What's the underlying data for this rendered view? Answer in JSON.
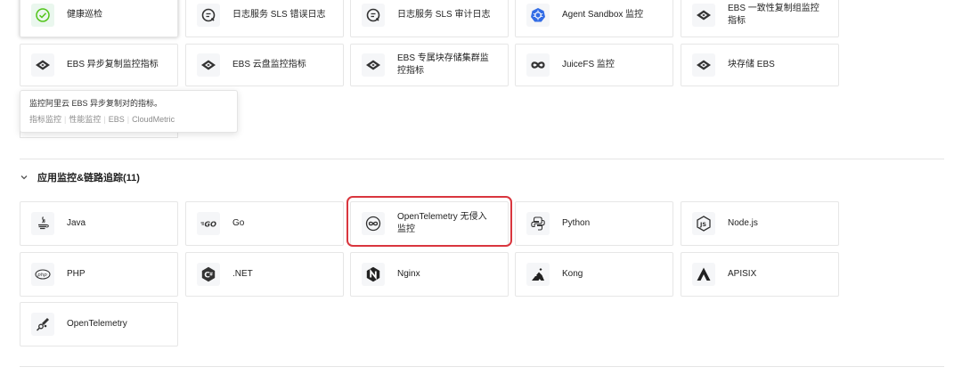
{
  "top_section": {
    "cards": [
      {
        "label": "健康巡检",
        "icon": "check-circle-icon"
      },
      {
        "label": "日志服务 SLS 错误日志",
        "icon": "sls-log-icon"
      },
      {
        "label": "日志服务 SLS 审计日志",
        "icon": "sls-log-icon"
      },
      {
        "label": "Agent Sandbox 监控",
        "icon": "kubernetes-icon"
      },
      {
        "label": "EBS 一致性复制组监控指标",
        "icon": "ebs-icon"
      },
      {
        "label": "EBS 异步复制监控指标",
        "icon": "ebs-icon"
      },
      {
        "label": "EBS 云盘监控指标",
        "icon": "ebs-icon"
      },
      {
        "label": "EBS 专属块存储集群监控指标",
        "icon": "ebs-icon"
      },
      {
        "label": "JuiceFS 监控",
        "icon": "juicefs-icon"
      },
      {
        "label": "块存储 EBS",
        "icon": "ebs-icon"
      }
    ]
  },
  "tooltip": {
    "description": "监控阿里云 EBS 异步复制对的指标。",
    "tags": [
      "指标监控",
      "性能监控",
      "EBS",
      "CloudMetric"
    ]
  },
  "app_section": {
    "title": "应用监控&链路追踪(11)",
    "cards": [
      {
        "label": "Java",
        "icon": "java-icon"
      },
      {
        "label": "Go",
        "icon": "go-icon"
      },
      {
        "label": "OpenTelemetry 无侵入监控",
        "icon": "opentelemetry-infinity-icon"
      },
      {
        "label": "Python",
        "icon": "python-icon"
      },
      {
        "label": "Node.js",
        "icon": "nodejs-icon"
      },
      {
        "label": "PHP",
        "icon": "php-icon"
      },
      {
        "label": ".NET",
        "icon": "dotnet-icon"
      },
      {
        "label": "Nginx",
        "icon": "nginx-icon"
      },
      {
        "label": "Kong",
        "icon": "kong-icon"
      },
      {
        "label": "APISIX",
        "icon": "apisix-icon"
      },
      {
        "label": "OpenTelemetry",
        "icon": "opentelemetry-icon"
      }
    ]
  },
  "colors": {
    "highlight_border": "#d9363e",
    "card_border": "#e6e6e6",
    "divider": "#e5e5e5"
  }
}
